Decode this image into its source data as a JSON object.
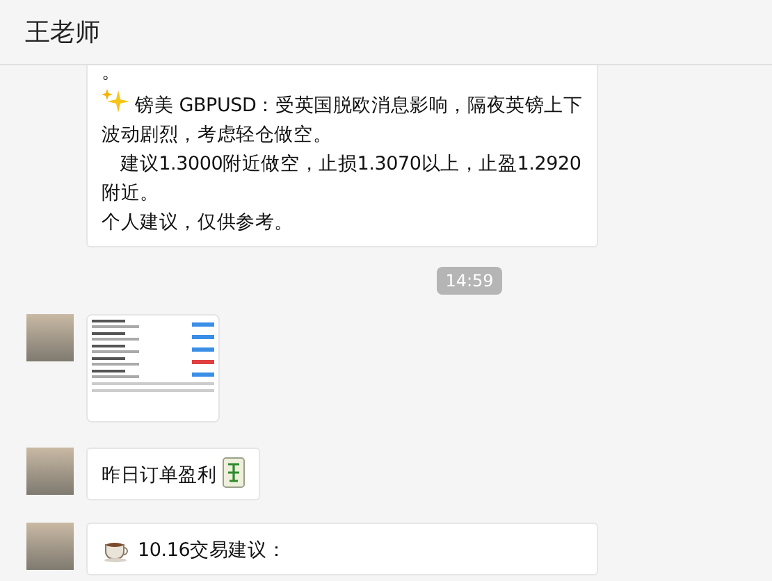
{
  "header": {
    "title": "王老师"
  },
  "messages": [
    {
      "kind": "text",
      "paragraphs": [
        {
          "kind": "plain",
          "text": "。"
        },
        {
          "kind": "sparkle",
          "text": "镑美 GBPUSD：受英国脱欧消息影响，隔夜英镑上下波动剧烈，考虑轻仓做空。"
        },
        {
          "kind": "indent",
          "text": "建议1.3000附近做空，止损1.3070以上，止盈1.2920附近。"
        },
        {
          "kind": "plain",
          "text": "个人建议，仅供参考。"
        }
      ]
    },
    {
      "kind": "time",
      "text": "14:59"
    },
    {
      "kind": "image"
    },
    {
      "kind": "text",
      "paragraphs": [
        {
          "kind": "tile",
          "text": "昨日订单盈利"
        }
      ]
    },
    {
      "kind": "text",
      "paragraphs": [
        {
          "kind": "cup",
          "text": "10.16交易建议："
        }
      ]
    }
  ]
}
